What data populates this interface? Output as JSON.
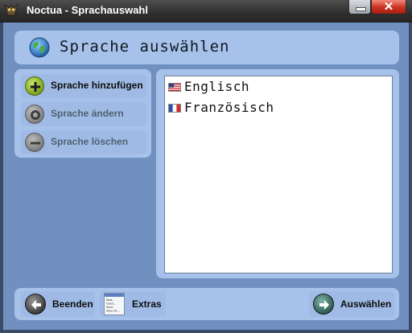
{
  "window": {
    "title": "Noctua - Sprachauswahl",
    "close_glyph": "✕"
  },
  "header": {
    "title": "Sprache auswählen",
    "icon": "globe-icon"
  },
  "sidebar": {
    "buttons": [
      {
        "label": "Sprache hinzufügen",
        "icon": "plus-icon",
        "enabled": true
      },
      {
        "label": "Sprache ändern",
        "icon": "gear-icon",
        "enabled": false
      },
      {
        "label": "Sprache löschen",
        "icon": "minus-icon",
        "enabled": false
      }
    ]
  },
  "languages": [
    {
      "name": "Englisch",
      "flag": "us-flag-icon"
    },
    {
      "name": "Französisch",
      "flag": "fr-flag-icon"
    }
  ],
  "footer": {
    "exit_label": "Beenden",
    "extras_label": "Extras",
    "select_label": "Auswählen",
    "extras_menu_lines": [
      "New...",
      "Open...",
      "Save",
      "Save As..."
    ]
  },
  "colors": {
    "window_bg": "#7090c0",
    "panel_bg": "#a7c2ea",
    "titlebar": "#333333",
    "close_button": "#c8301f"
  }
}
